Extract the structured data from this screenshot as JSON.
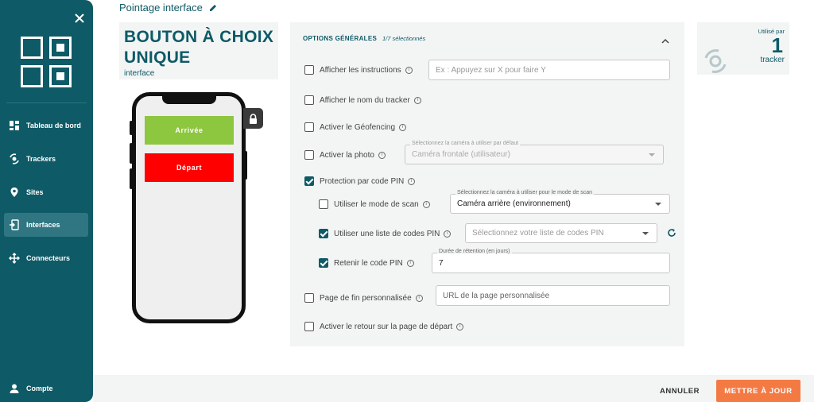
{
  "sidebar": {
    "items": [
      {
        "label": "Tableau de bord",
        "icon": "dashboard-icon"
      },
      {
        "label": "Trackers",
        "icon": "tracker-icon"
      },
      {
        "label": "Sites",
        "icon": "location-pin-icon"
      },
      {
        "label": "Interfaces",
        "icon": "interface-icon"
      },
      {
        "label": "Connecteurs",
        "icon": "connectors-icon"
      }
    ],
    "account_label": "Compte"
  },
  "header": {
    "title": "Pointage interface"
  },
  "interface_type": {
    "title": "BOUTON À CHOIX UNIQUE",
    "subtitle": "interface"
  },
  "phone": {
    "buttons": [
      {
        "label": "Arrivée",
        "color": "#8dc63f"
      },
      {
        "label": "Départ",
        "color": "#ff0000"
      }
    ]
  },
  "options": {
    "header": "OPTIONS GÉNÉRALES",
    "count": "1/7 sélectionnés",
    "items": {
      "instructions": {
        "label": "Afficher les instructions",
        "checked": false,
        "placeholder": "Ex : Appuyez sur X pour faire Y"
      },
      "tracker_name": {
        "label": "Afficher le nom du tracker",
        "checked": false
      },
      "geofencing": {
        "label": "Activer le Géofencing",
        "checked": false
      },
      "photo": {
        "label": "Activer la photo",
        "checked": false,
        "select_label": "Sélectionnez la caméra à utiliser par défaut",
        "select_value": "Caméra frontale (utilisateur)"
      },
      "pin": {
        "label": "Protection par code PIN",
        "checked": true
      },
      "scan": {
        "label": "Utiliser le mode de scan",
        "checked": false,
        "select_label": "Sélectionnez la caméra à utiliser pour le mode de scan",
        "select_value": "Caméra arrière (environnement)"
      },
      "pin_list": {
        "label": "Utiliser une liste de codes PIN",
        "checked": true,
        "placeholder": "Sélectionnez votre liste de codes PIN"
      },
      "retain_pin": {
        "label": "Retenir le code PIN",
        "checked": true,
        "field_label": "Durée de rétention (en jours)",
        "value": "7"
      },
      "end_page": {
        "label": "Page de fin personnalisée",
        "checked": false,
        "placeholder": "URL de la page personnalisée"
      },
      "return_start": {
        "label": "Activer le retour sur la page de départ",
        "checked": false
      }
    }
  },
  "usage": {
    "label": "Utilisé par",
    "count": "1",
    "unit": "tracker"
  },
  "footer": {
    "cancel": "ANNULER",
    "update": "METTRE À JOUR"
  },
  "colors": {
    "brand": "#0e5a66",
    "accent": "#f47a44"
  }
}
